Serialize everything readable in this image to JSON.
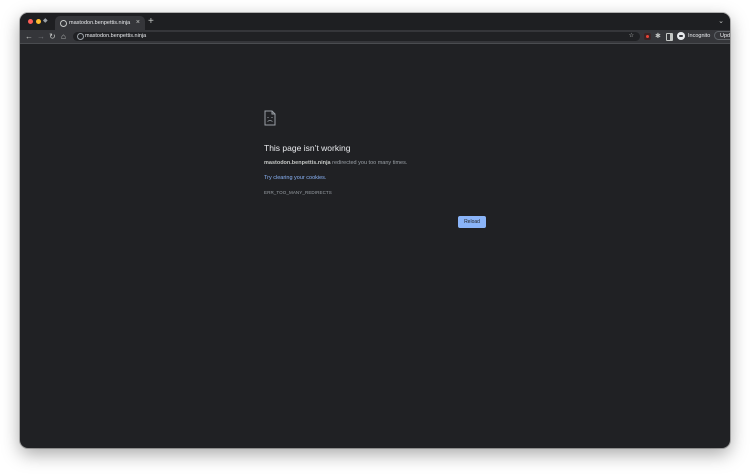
{
  "tab": {
    "title": "mastodon.benpettis.ninja",
    "close_glyph": "×",
    "new_tab_glyph": "+"
  },
  "toolbar": {
    "url": "mastodon.benpettis.ninja",
    "incognito_label": "Incognito",
    "update_label": "Update"
  },
  "error": {
    "title": "This page isn’t working",
    "host": "mastodon.benpettis.ninja",
    "message": "redirected you too many times.",
    "suggestion": "Try clearing your cookies.",
    "code": "ERR_TOO_MANY_REDIRECTS",
    "reload_label": "Reload"
  },
  "icons": {
    "back": "arrow-left-icon",
    "forward": "arrow-right-icon",
    "reload": "reload-icon",
    "home": "home-icon",
    "star": "star-icon",
    "extensions": "puzzle-icon",
    "side_panel": "side-panel-icon",
    "incognito": "incognito-icon",
    "menu": "kebab-menu-icon",
    "error": "sad-page-icon"
  },
  "colors": {
    "background": "#202124",
    "link": "#8ab4f8",
    "button": "#8ab4f8"
  }
}
